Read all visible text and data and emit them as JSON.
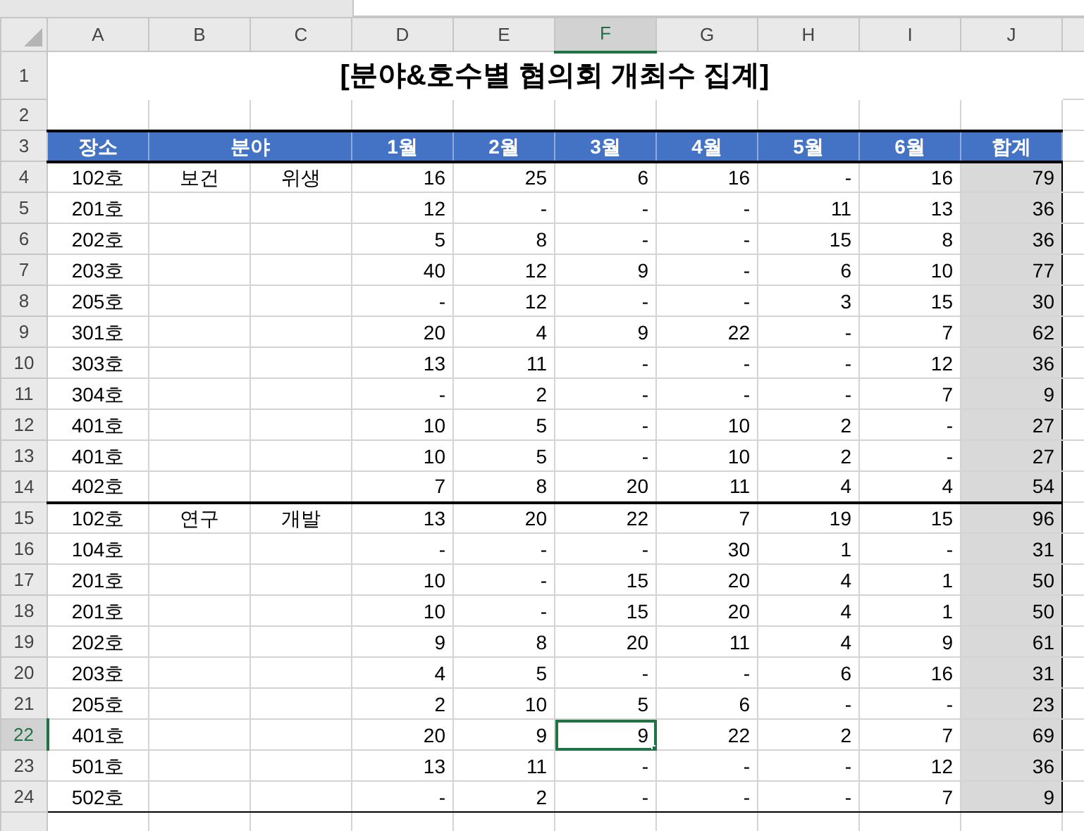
{
  "column_headers": [
    {
      "label": "A",
      "selected": false
    },
    {
      "label": "B",
      "selected": false
    },
    {
      "label": "C",
      "selected": false
    },
    {
      "label": "D",
      "selected": false
    },
    {
      "label": "E",
      "selected": false
    },
    {
      "label": "F",
      "selected": true
    },
    {
      "label": "G",
      "selected": false
    },
    {
      "label": "H",
      "selected": false
    },
    {
      "label": "I",
      "selected": false
    },
    {
      "label": "J",
      "selected": false
    }
  ],
  "title_row": {
    "number": "1",
    "selected": false,
    "text": "[분야&호수별 협의회 개최수 집계]"
  },
  "blank_row": {
    "number": "2",
    "selected": false
  },
  "header_row": {
    "number": "3",
    "selected": false,
    "place": "장소",
    "field": "분야",
    "months": [
      "1월",
      "2월",
      "3월",
      "4월",
      "5월",
      "6월"
    ],
    "total": "합계"
  },
  "data_rows": [
    {
      "number": "4",
      "selected": false,
      "group_start": true,
      "place": "102호",
      "field_1": "보건",
      "field_2": "위생",
      "months": [
        "16",
        "25",
        "6",
        "16",
        "-",
        "16"
      ],
      "total": "79"
    },
    {
      "number": "5",
      "selected": false,
      "group_start": false,
      "place": "201호",
      "months": [
        "12",
        "-",
        "-",
        "-",
        "11",
        "13"
      ],
      "total": "36"
    },
    {
      "number": "6",
      "selected": false,
      "group_start": false,
      "place": "202호",
      "months": [
        "5",
        "8",
        "-",
        "-",
        "15",
        "8"
      ],
      "total": "36"
    },
    {
      "number": "7",
      "selected": false,
      "group_start": false,
      "place": "203호",
      "months": [
        "40",
        "12",
        "9",
        "-",
        "6",
        "10"
      ],
      "total": "77"
    },
    {
      "number": "8",
      "selected": false,
      "group_start": false,
      "place": "205호",
      "months": [
        "-",
        "12",
        "-",
        "-",
        "3",
        "15"
      ],
      "total": "30"
    },
    {
      "number": "9",
      "selected": false,
      "group_start": false,
      "place": "301호",
      "months": [
        "20",
        "4",
        "9",
        "22",
        "-",
        "7"
      ],
      "total": "62"
    },
    {
      "number": "10",
      "selected": false,
      "group_start": false,
      "place": "303호",
      "months": [
        "13",
        "11",
        "-",
        "-",
        "-",
        "12"
      ],
      "total": "36"
    },
    {
      "number": "11",
      "selected": false,
      "group_start": false,
      "place": "304호",
      "months": [
        "-",
        "2",
        "-",
        "-",
        "-",
        "7"
      ],
      "total": "9"
    },
    {
      "number": "12",
      "selected": false,
      "group_start": false,
      "place": "401호",
      "months": [
        "10",
        "5",
        "-",
        "10",
        "2",
        "-"
      ],
      "total": "27"
    },
    {
      "number": "13",
      "selected": false,
      "group_start": false,
      "place": "401호",
      "months": [
        "10",
        "5",
        "-",
        "10",
        "2",
        "-"
      ],
      "total": "27"
    },
    {
      "number": "14",
      "selected": false,
      "group_start": false,
      "place": "402호",
      "months": [
        "7",
        "8",
        "20",
        "11",
        "4",
        "4"
      ],
      "total": "54"
    },
    {
      "number": "15",
      "selected": false,
      "group_start": true,
      "place": "102호",
      "field_1": "연구",
      "field_2": "개발",
      "months": [
        "13",
        "20",
        "22",
        "7",
        "19",
        "15"
      ],
      "total": "96"
    },
    {
      "number": "16",
      "selected": false,
      "group_start": false,
      "place": "104호",
      "months": [
        "-",
        "-",
        "-",
        "30",
        "1",
        "-"
      ],
      "total": "31"
    },
    {
      "number": "17",
      "selected": false,
      "group_start": false,
      "place": "201호",
      "months": [
        "10",
        "-",
        "15",
        "20",
        "4",
        "1"
      ],
      "total": "50"
    },
    {
      "number": "18",
      "selected": false,
      "group_start": false,
      "place": "201호",
      "months": [
        "10",
        "-",
        "15",
        "20",
        "4",
        "1"
      ],
      "total": "50"
    },
    {
      "number": "19",
      "selected": false,
      "group_start": false,
      "place": "202호",
      "months": [
        "9",
        "8",
        "20",
        "11",
        "4",
        "9"
      ],
      "total": "61"
    },
    {
      "number": "20",
      "selected": false,
      "group_start": false,
      "place": "203호",
      "months": [
        "4",
        "5",
        "-",
        "-",
        "6",
        "16"
      ],
      "total": "31"
    },
    {
      "number": "21",
      "selected": false,
      "group_start": false,
      "place": "205호",
      "months": [
        "2",
        "10",
        "5",
        "6",
        "-",
        "-"
      ],
      "total": "23"
    },
    {
      "number": "22",
      "selected": true,
      "group_start": false,
      "place": "401호",
      "months": [
        "20",
        "9",
        "9",
        "22",
        "2",
        "7"
      ],
      "total": "69"
    },
    {
      "number": "23",
      "selected": false,
      "group_start": false,
      "place": "501호",
      "months": [
        "13",
        "11",
        "-",
        "-",
        "-",
        "12"
      ],
      "total": "36"
    },
    {
      "number": "24",
      "selected": false,
      "group_start": false,
      "place": "502호",
      "months": [
        "-",
        "2",
        "-",
        "-",
        "-",
        "7"
      ],
      "total": "9"
    }
  ]
}
